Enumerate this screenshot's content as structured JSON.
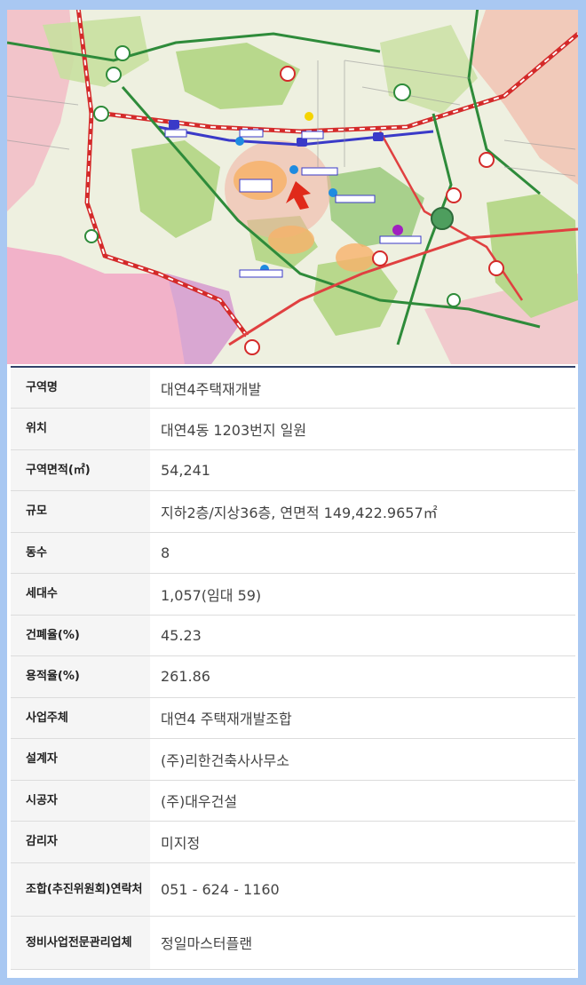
{
  "map": {
    "icon": "location-map",
    "colors": {
      "park": "#b8d88c",
      "water": "#f2a7c4",
      "rail": "#d42a2a",
      "subway": "#3a3ac8",
      "road": "#2e8b3a",
      "zone": "#f3b0a0",
      "highlight": "#f7b26a"
    }
  },
  "table": {
    "rows": [
      {
        "label": "구역명",
        "value": "대연4주택재개발"
      },
      {
        "label": "위치",
        "value": "대연4동 1203번지 일원"
      },
      {
        "label": "구역면적(㎡)",
        "value": "54,241"
      },
      {
        "label": "규모",
        "value": "지하2층/지상36층, 연면적 149,422.9657㎡"
      },
      {
        "label": "동수",
        "value": "8"
      },
      {
        "label": "세대수",
        "value": "1,057(임대 59)"
      },
      {
        "label": "건폐율(%)",
        "value": "45.23"
      },
      {
        "label": "용적율(%)",
        "value": "261.86"
      },
      {
        "label": "사업주체",
        "value": "대연4 주택재개발조합"
      },
      {
        "label": "설계자",
        "value": "(주)리한건축사사무소"
      },
      {
        "label": "시공자",
        "value": "(주)대우건설"
      },
      {
        "label": "감리자",
        "value": "미지정"
      },
      {
        "label": "조합(추진위원회)연락처",
        "value": "051 - 624 - 1160"
      },
      {
        "label": "정비사업전문관리업체",
        "value": "정일마스터플랜"
      }
    ]
  }
}
